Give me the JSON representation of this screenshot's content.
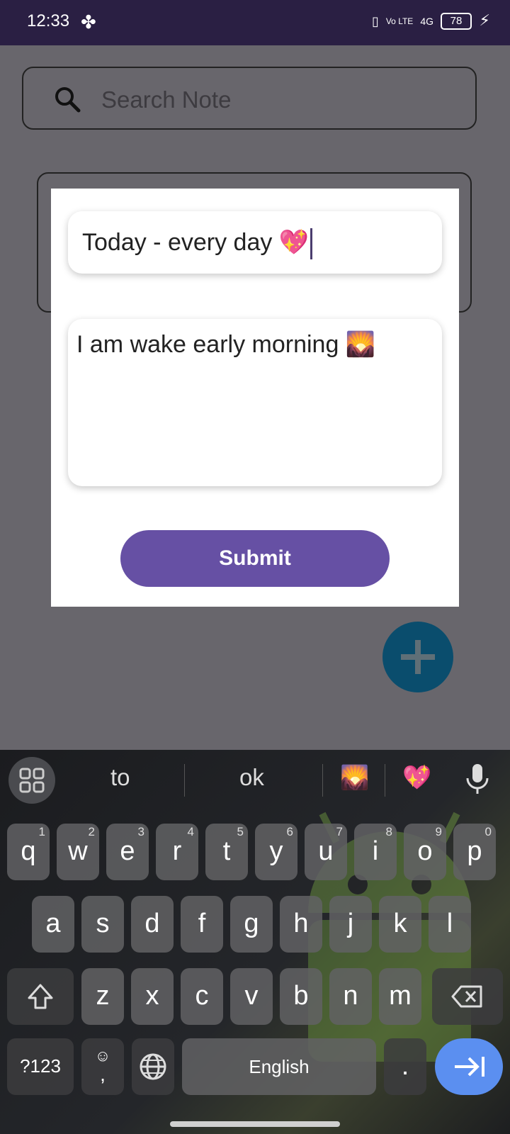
{
  "status": {
    "time": "12:33",
    "fan": "✤",
    "vibrate": "▯",
    "volte": "Vo LTE",
    "signal": "4G",
    "battery": "78",
    "charge": "⚡"
  },
  "search": {
    "placeholder": "Search Note"
  },
  "dialog": {
    "title_value": "Today - every day 💖",
    "body_value": "I am wake early morning 🌄",
    "submit_label": "Submit"
  },
  "keyboard": {
    "suggestions": [
      "to",
      "ok",
      "🌄",
      "💖"
    ],
    "row1": [
      {
        "k": "q",
        "n": "1"
      },
      {
        "k": "w",
        "n": "2"
      },
      {
        "k": "e",
        "n": "3"
      },
      {
        "k": "r",
        "n": "4"
      },
      {
        "k": "t",
        "n": "5"
      },
      {
        "k": "y",
        "n": "6"
      },
      {
        "k": "u",
        "n": "7"
      },
      {
        "k": "i",
        "n": "8"
      },
      {
        "k": "o",
        "n": "9"
      },
      {
        "k": "p",
        "n": "0"
      }
    ],
    "row2": [
      "a",
      "s",
      "d",
      "f",
      "g",
      "h",
      "j",
      "k",
      "l"
    ],
    "row3": [
      "z",
      "x",
      "c",
      "v",
      "b",
      "n",
      "m"
    ],
    "symbols_label": "?123",
    "emoji_key": "☺",
    "comma": ",",
    "space_label": "English",
    "period": "."
  }
}
